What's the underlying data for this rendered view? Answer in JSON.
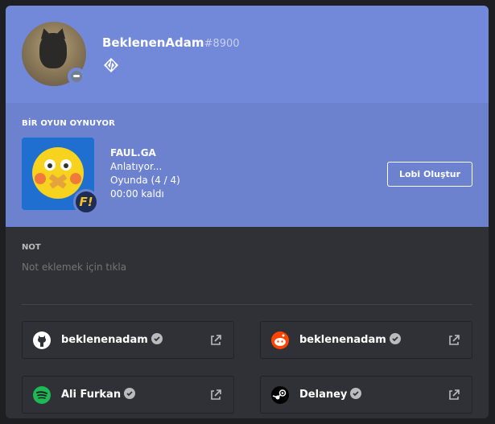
{
  "user": {
    "username": "BeklenenAdam",
    "discriminator": "#8900"
  },
  "activity": {
    "section_title": "BİR OYUN OYNUYOR",
    "game_name": "FAUL.GA",
    "details": "Anlatıyor...",
    "state": "Oyunda (4 / 4)",
    "elapsed": "00:00 kaldı",
    "lobby_button": "Lobi Oluştur"
  },
  "note": {
    "title": "NOT",
    "placeholder": "Not eklemek için tıkla"
  },
  "connections": [
    {
      "service_icon": "github-icon",
      "name": "beklenenadam"
    },
    {
      "service_icon": "reddit-icon",
      "name": "beklenenadam"
    },
    {
      "service_icon": "spotify-icon",
      "name": "Ali Furkan"
    },
    {
      "service_icon": "steam-icon",
      "name": "Delaney"
    }
  ],
  "colors": {
    "header": "#7289da",
    "activity": "#6c82cf",
    "body": "#2f3136",
    "github": "#ffffff",
    "reddit": "#ff4500",
    "spotify": "#1db954",
    "steam": "#000000"
  }
}
